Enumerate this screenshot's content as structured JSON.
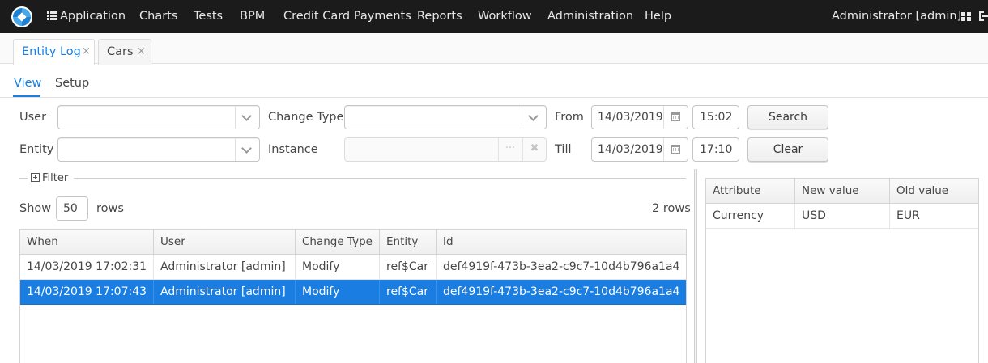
{
  "topbar": {
    "menu": [
      "Application",
      "Charts",
      "Tests",
      "BPM",
      "Credit Card Payments",
      "Reports",
      "Workflow",
      "Administration",
      "Help"
    ],
    "user": "Administrator [admin]"
  },
  "tabs": [
    {
      "label": "Entity Log",
      "close": "×"
    },
    {
      "label": "Cars",
      "close": "×"
    }
  ],
  "subtabs": {
    "view": "View",
    "setup": "Setup"
  },
  "form": {
    "user_label": "User",
    "user_value": "",
    "change_type_label": "Change Type",
    "change_type_value": "",
    "entity_label": "Entity",
    "entity_value": "",
    "instance_label": "Instance",
    "instance_value": "",
    "from_label": "From",
    "from_date": "14/03/2019",
    "from_time": "15:02",
    "till_label": "Till",
    "till_date": "14/03/2019",
    "till_time": "17:10",
    "search_label": "Search",
    "clear_label": "Clear",
    "picker_dots": "···",
    "picker_clear": "✖"
  },
  "filter": {
    "label": "Filter"
  },
  "rows": {
    "show_label": "Show",
    "value": "50",
    "rows_label": "rows",
    "count": "2 rows"
  },
  "log_table": {
    "columns": [
      "When",
      "User",
      "Change Type",
      "Entity",
      "Id"
    ],
    "rows": [
      [
        "14/03/2019 17:02:31",
        "Administrator [admin]",
        "Modify",
        "ref$Car",
        "def4919f-473b-3ea2-c9c7-10d4b796a1a4"
      ],
      [
        "14/03/2019 17:07:43",
        "Administrator [admin]",
        "Modify",
        "ref$Car",
        "def4919f-473b-3ea2-c9c7-10d4b796a1a4"
      ]
    ],
    "selected_row": 1
  },
  "diff_table": {
    "columns": [
      "Attribute",
      "New value",
      "Old value"
    ],
    "rows": [
      [
        "Currency",
        "USD",
        "EUR"
      ]
    ]
  },
  "colors": {
    "accent": "#197de1",
    "topbar": "#1b1b1b"
  }
}
